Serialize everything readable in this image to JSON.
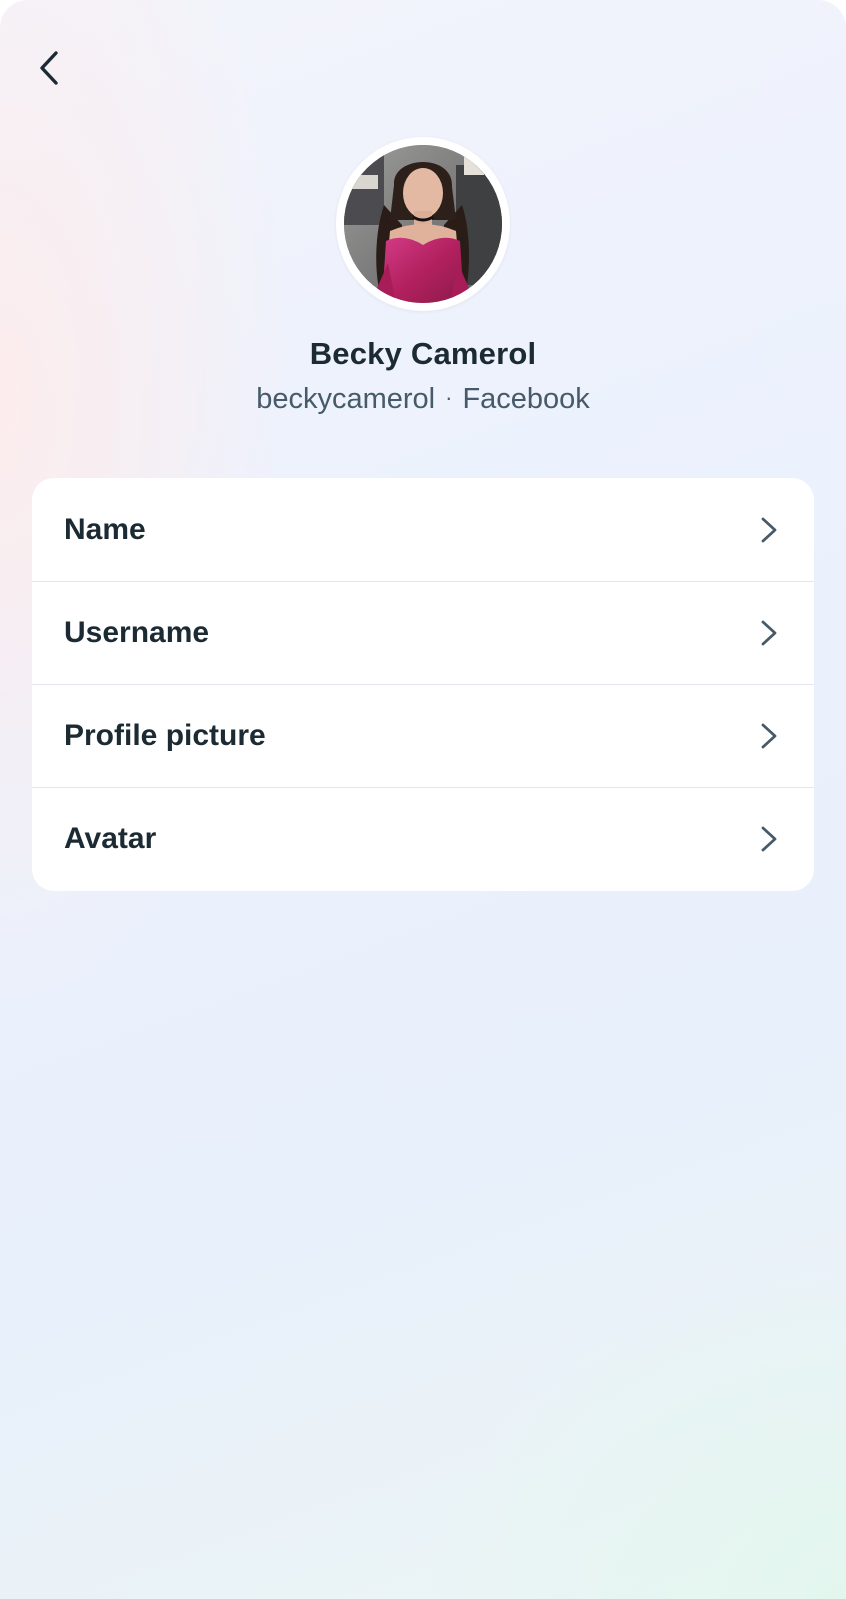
{
  "header": {
    "back_icon": "chevron-left-icon"
  },
  "profile": {
    "display_name": "Becky Camerol",
    "username": "beckycamerol",
    "separator": "·",
    "platform": "Facebook",
    "avatar_description": "profile photo"
  },
  "settings": {
    "items": [
      {
        "label": "Name",
        "icon": "chevron-right-icon"
      },
      {
        "label": "Username",
        "icon": "chevron-right-icon"
      },
      {
        "label": "Profile picture",
        "icon": "chevron-right-icon"
      },
      {
        "label": "Avatar",
        "icon": "chevron-right-icon"
      }
    ]
  },
  "colors": {
    "text_primary": "#1c2b33",
    "text_secondary": "#465a69",
    "card_bg": "#ffffff",
    "divider": "#e4e6eb",
    "avatar_outfit": "#b8246a"
  }
}
